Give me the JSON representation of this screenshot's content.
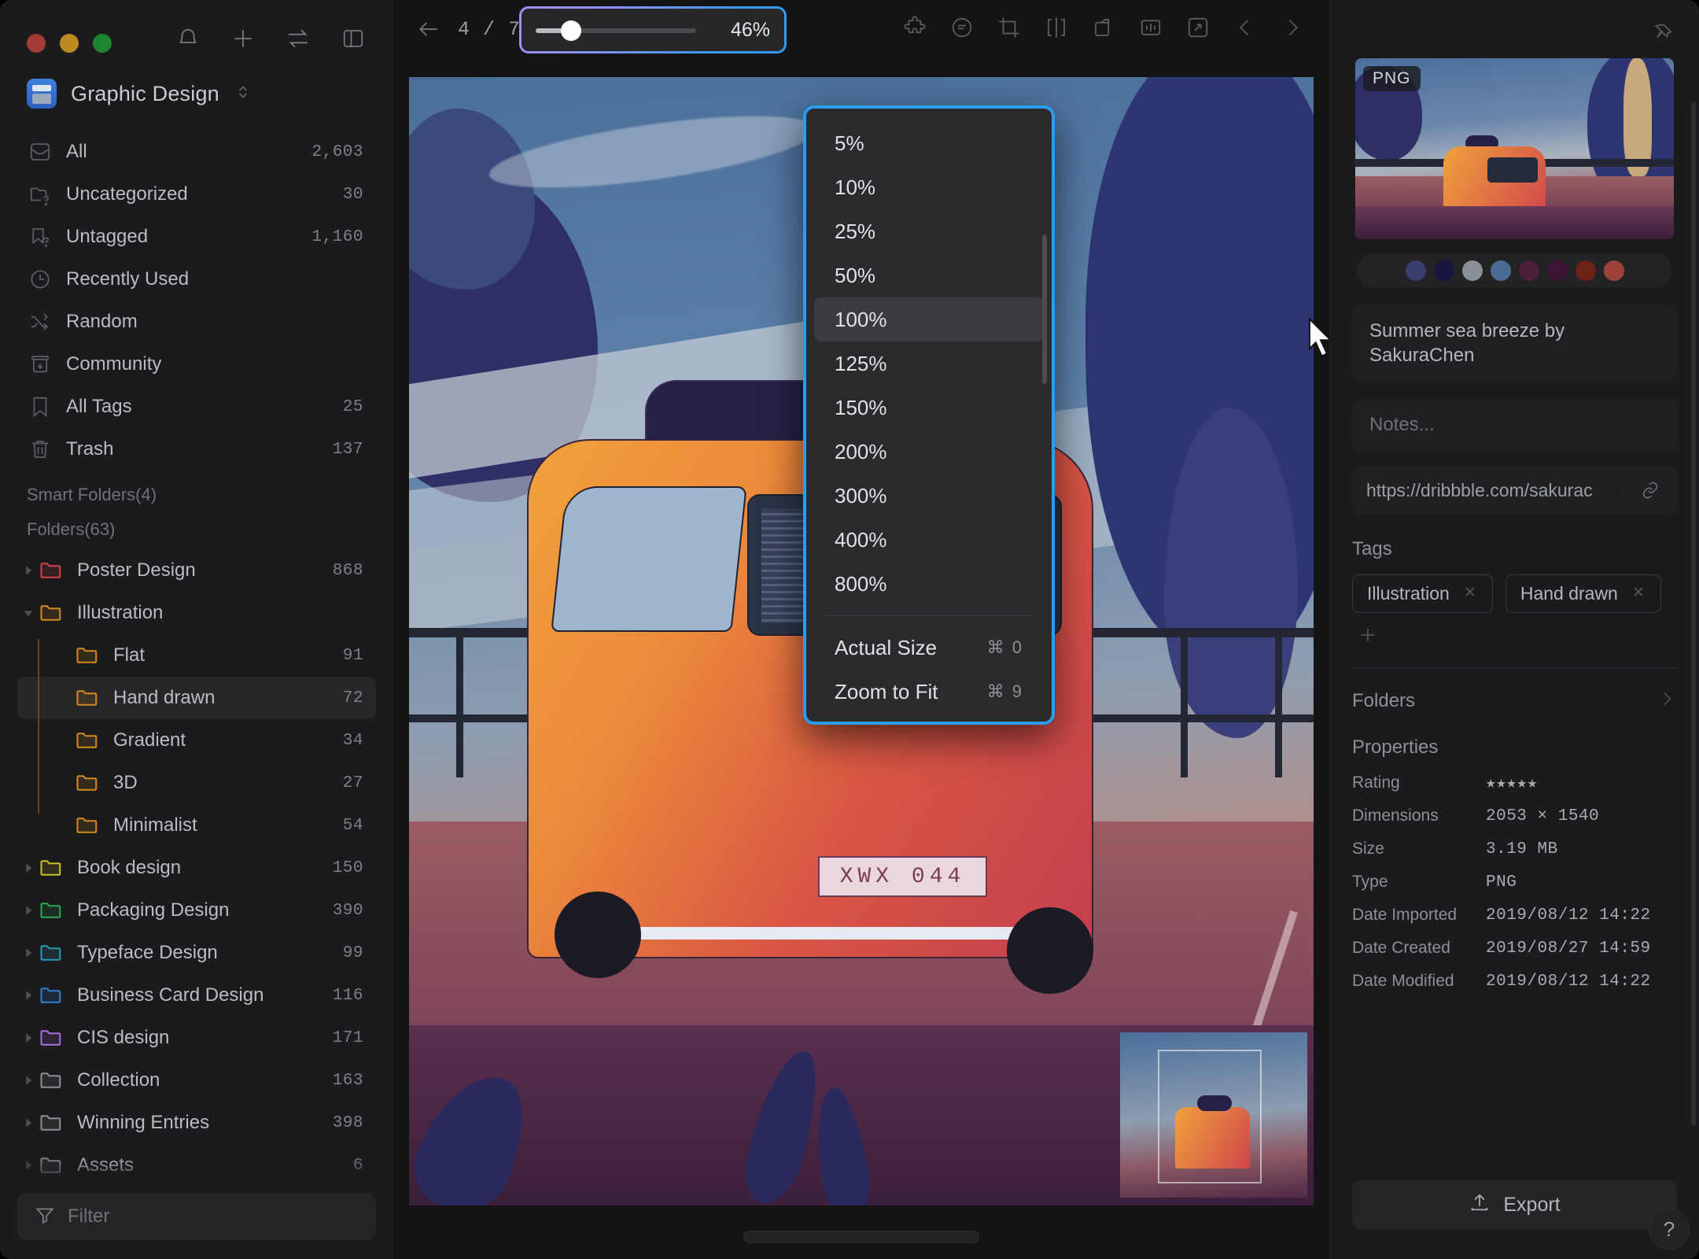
{
  "window": {
    "traffic_lights": [
      "close",
      "minimize",
      "maximize"
    ],
    "header_icons": [
      "bell-icon",
      "plus-icon",
      "transfer-icon",
      "panel-toggle-icon"
    ]
  },
  "sidebar": {
    "library_name": "Graphic Design",
    "nav": [
      {
        "icon": "inbox-icon",
        "label": "All",
        "count": "2,603"
      },
      {
        "icon": "folder-question-icon",
        "label": "Uncategorized",
        "count": "30"
      },
      {
        "icon": "tag-question-icon",
        "label": "Untagged",
        "count": "1,160"
      },
      {
        "icon": "clock-icon",
        "label": "Recently Used",
        "count": ""
      },
      {
        "icon": "shuffle-icon",
        "label": "Random",
        "count": ""
      },
      {
        "icon": "community-icon",
        "label": "Community",
        "count": ""
      },
      {
        "icon": "bookmark-icon",
        "label": "All Tags",
        "count": "25"
      },
      {
        "icon": "trash-icon",
        "label": "Trash",
        "count": "137"
      }
    ],
    "smart_folders_label": "Smart Folders(4)",
    "folders_label": "Folders(63)",
    "folders": [
      {
        "label": "Poster Design",
        "count": "868",
        "color": "#d8414b",
        "depth": 0,
        "expanded": false,
        "selected": false
      },
      {
        "label": "Illustration",
        "count": "",
        "color": "#d68a1e",
        "depth": 0,
        "expanded": true,
        "selected": false
      },
      {
        "label": "Flat",
        "count": "91",
        "color": "#d68a1e",
        "depth": 1,
        "expanded": null,
        "selected": false
      },
      {
        "label": "Hand drawn",
        "count": "72",
        "color": "#d68a1e",
        "depth": 1,
        "expanded": null,
        "selected": true
      },
      {
        "label": "Gradient",
        "count": "34",
        "color": "#d68a1e",
        "depth": 1,
        "expanded": null,
        "selected": false
      },
      {
        "label": "3D",
        "count": "27",
        "color": "#d68a1e",
        "depth": 1,
        "expanded": null,
        "selected": false
      },
      {
        "label": "Minimalist",
        "count": "54",
        "color": "#d68a1e",
        "depth": 1,
        "expanded": null,
        "selected": false
      },
      {
        "label": "Book design",
        "count": "150",
        "color": "#cdc325",
        "depth": 0,
        "expanded": false,
        "selected": false
      },
      {
        "label": "Packaging Design",
        "count": "390",
        "color": "#2aa84a",
        "depth": 0,
        "expanded": false,
        "selected": false
      },
      {
        "label": "Typeface Design",
        "count": "99",
        "color": "#2b9ab5",
        "depth": 0,
        "expanded": false,
        "selected": false
      },
      {
        "label": "Business Card Design",
        "count": "116",
        "color": "#2f7fd4",
        "depth": 0,
        "expanded": false,
        "selected": false
      },
      {
        "label": "CIS design",
        "count": "171",
        "color": "#a96fe0",
        "depth": 0,
        "expanded": false,
        "selected": false
      },
      {
        "label": "Collection",
        "count": "163",
        "color": "#8b8f95",
        "depth": 0,
        "expanded": false,
        "selected": false
      },
      {
        "label": "Winning Entries",
        "count": "398",
        "color": "#8b8f95",
        "depth": 0,
        "expanded": false,
        "selected": false
      },
      {
        "label": "Assets",
        "count": "6",
        "color": "#8b8f95",
        "depth": 0,
        "expanded": false,
        "selected": false
      }
    ],
    "filter_placeholder": "Filter"
  },
  "toolbar": {
    "back_icon": "arrow-left-icon",
    "counter": "4 / 7",
    "zoom_percent": "46%",
    "slider_value": 46,
    "icons": [
      "puzzle-plugin-icon",
      "annotation-icon",
      "crop-icon",
      "mirror-icon",
      "rotate-icon",
      "compare-icon",
      "fullscreen-icon",
      "prev-icon",
      "next-icon"
    ]
  },
  "zoom_menu": {
    "presets": [
      "5%",
      "10%",
      "25%",
      "50%",
      "100%",
      "125%",
      "150%",
      "200%",
      "300%",
      "400%",
      "800%"
    ],
    "highlighted": "100%",
    "actions": [
      {
        "label": "Actual Size",
        "shortcut": "⌘ 0"
      },
      {
        "label": "Zoom to Fit",
        "shortcut": "⌘ 9"
      }
    ]
  },
  "artwork": {
    "license_plate": "XWX  044"
  },
  "inspector": {
    "pin_icon": "pin-icon",
    "format_badge": "PNG",
    "palette": [
      "#3b3f70",
      "#181640",
      "#8b8f96",
      "#4a6b93",
      "#4b2038",
      "#3f1333",
      "#6e2316",
      "#9d4137"
    ],
    "title": "Summer sea breeze by SakuraChen",
    "notes_placeholder": "Notes...",
    "url": "https://dribbble.com/sakurac",
    "tags_label": "Tags",
    "tags": [
      "Illustration",
      "Hand drawn"
    ],
    "add_tag_icon": "plus-icon",
    "folders_label": "Folders",
    "properties_label": "Properties",
    "properties": [
      {
        "key": "Rating",
        "value": "★★★★★",
        "is_rating": true
      },
      {
        "key": "Dimensions",
        "value": "2053 × 1540"
      },
      {
        "key": "Size",
        "value": "3.19 MB"
      },
      {
        "key": "Type",
        "value": "PNG"
      },
      {
        "key": "Date Imported",
        "value": "2019/08/12 14:22"
      },
      {
        "key": "Date Created",
        "value": "2019/08/27 14:59"
      },
      {
        "key": "Date Modified",
        "value": "2019/08/12 14:22"
      }
    ],
    "export_label": "Export",
    "help_label": "?"
  }
}
